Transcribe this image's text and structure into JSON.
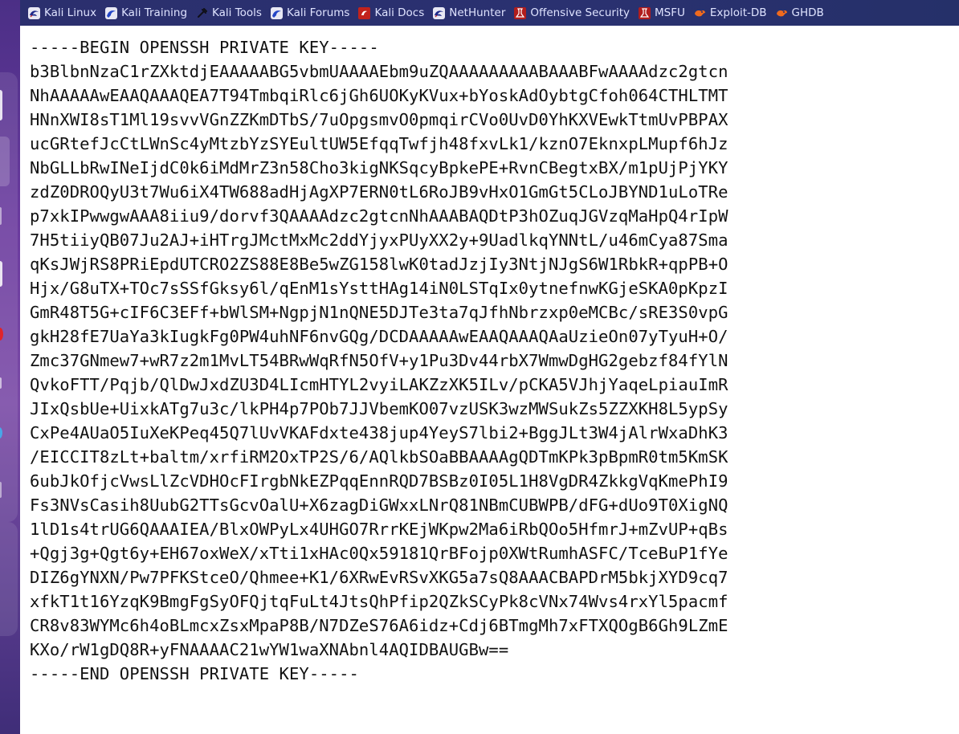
{
  "bookmarks": [
    {
      "label": "Kali Linux",
      "icon": "kali-dragon-icon"
    },
    {
      "label": "Kali Training",
      "icon": "kali-training-icon"
    },
    {
      "label": "Kali Tools",
      "icon": "kali-tools-icon"
    },
    {
      "label": "Kali Forums",
      "icon": "kali-forums-icon"
    },
    {
      "label": "Kali Docs",
      "icon": "kali-docs-icon"
    },
    {
      "label": "NetHunter",
      "icon": "nethunter-icon"
    },
    {
      "label": "Offensive Security",
      "icon": "offensive-security-icon"
    },
    {
      "label": "MSFU",
      "icon": "msfu-icon"
    },
    {
      "label": "Exploit-DB",
      "icon": "exploit-db-icon"
    },
    {
      "label": "GHDB",
      "icon": "ghdb-icon"
    }
  ],
  "key": {
    "lines": [
      "-----BEGIN OPENSSH PRIVATE KEY-----",
      "b3BlbnNzaC1rZXktdjEAAAAABG5vbmUAAAAEbm9uZQAAAAAAAAABAAABFwAAAAdzc2gtcn",
      "NhAAAAAwEAAQAAAQEA7T94TmbqiRlc6jGh6UOKyKVux+bYoskAdOybtgCfoh064CTHLTMT",
      "HNnXWI8sT1Ml19svvVGnZZKmDTbS/7uOpgsmvO0pmqirCVo0UvD0YhKXVEwkTtmUvPBPAX",
      "ucGRtefJcCtLWnSc4yMtzbYzSYEultUW5EfqqTwfjh48fxvLk1/kznO7EknxpLMupf6hJz",
      "NbGLLbRwINeIjdC0k6iMdMrZ3n58Cho3kigNKSqcyBpkePE+RvnCBegtxBX/m1pUjPjYKY",
      "zdZ0DROQyU3t7Wu6iX4TW688adHjAgXP7ERN0tL6RoJB9vHxO1GmGt5CLoJBYND1uLoTRe",
      "p7xkIPwwgwAAA8iiu9/dorvf3QAAAAdzc2gtcnNhAAABAQDtP3hOZuqJGVzqMaHpQ4rIpW",
      "7H5tiiyQB07Ju2AJ+iHTrgJMctMxMc2ddYjyxPUyXX2y+9UadlkqYNNtL/u46mCya87Sma",
      "qKsJWjRS8PRiEpdUTCRO2ZS88E8Be5wZG158lwK0tadJzjIy3NtjNJgS6W1RbkR+qpPB+O",
      "Hjx/G8uTX+TOc7sSSfGksy6l/qEnM1sYsttHAg14iN0LSTqIx0ytnefnwKGjeSKA0pKpzI",
      "GmR48T5G+cIF6C3EFf+bWlSM+NgpjN1nQNE5DJTe3ta7qJfhNbrzxp0eMCBc/sRE3S0vpG",
      "gkH28fE7UaYa3kIugkFg0PW4uhNF6nvGQg/DCDAAAAAwEAAQAAAQAaUzieOn07yTyuH+O/",
      "Zmc37GNmew7+wR7z2m1MvLT54BRwWqRfN5OfV+y1Pu3Dv44rbX7WmwDgHG2gebzf84fYlN",
      "QvkoFTT/Pqjb/QlDwJxdZU3D4LIcmHTYL2vyiLAKZzXK5ILv/pCKA5VJhjYaqeLpiauImR",
      "JIxQsbUe+UixkATg7u3c/lkPH4p7POb7JJVbemKO07vzUSK3wzMWSukZs5ZZXKH8L5ypSy",
      "CxPe4AUaO5IuXeKPeq45Q7lUvVKAFdxte438jup4YeyS7lbi2+BggJLt3W4jAlrWxaDhK3",
      "/EICCIT8zLt+baltm/xrfiRM2OxTP2S/6/AQlkbSOaBBAAAAgQDTmKPk3pBpmR0tm5KmSK",
      "6ubJkOfjcVwsLlZcVDHOcFIrgbNkEZPqqEnnRQD7BSBz0I05L1H8VgDR4ZkkgVqKmePhI9",
      "Fs3NVsCasih8UubG2TTsGcvOalU+X6zagDiGWxxLNrQ81NBmCUBWPB/dFG+dUo9T0XigNQ",
      "1lD1s4trUG6QAAAIEA/BlxOWPyLx4UHGO7RrrKEjWKpw2Ma6iRbQOo5HfmrJ+mZvUP+qBs",
      "+Qgj3g+Qgt6y+EH67oxWeX/xTti1xHAc0Qx59181QrBFojp0XWtRumhASFC/TceBuP1fYe",
      "DIZ6gYNXN/Pw7PFKStceO/Qhmee+K1/6XRwEvRSvXKG5a7sQ8AAACBAPDrM5bkjXYD9cq7",
      "xfkT1t16YzqK9BmgFgSyOFQjtqFuLt4JtsQhPfip2QZkSCyPk8cVNx74Wvs4rxYl5pacmf",
      "CR8v83WYMc6h4oBLmcxZsxMpaP8B/N7DZeS76A6idz+Cdj6BTmgMh7xFTXQOgB6Gh9LZmE",
      "KXo/rW1gDQ8R+yFNAAAAC21wYW1waXNAbnl4AQIDBAUGBw==",
      "-----END OPENSSH PRIVATE KEY-----"
    ]
  },
  "colors": {
    "toolbar_bg": "#2b2f6e",
    "toolbar_text": "#dfe3ff",
    "dock_bg": "#5a3c8e",
    "content_bg": "#ffffff",
    "text": "#111111"
  }
}
